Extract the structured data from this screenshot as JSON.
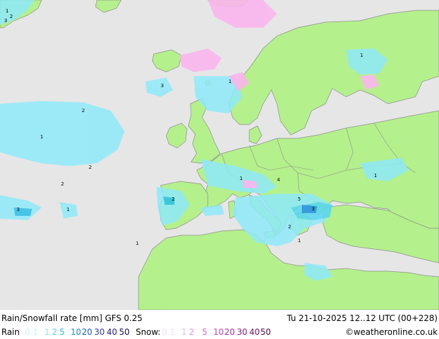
{
  "title": "Rain/Snowfall rate [mm] GFS 0.25",
  "datetime": "Tu 21-10-2025 12..12 UTC (00+228)",
  "credit": "©weatheronline.co.uk",
  "legend": {
    "rain_label": "Rain",
    "rain_scale": [
      {
        "v": "0.1",
        "c": "#bff5ff"
      },
      {
        "v": "1",
        "c": "#8ee9f9"
      },
      {
        "v": "2",
        "c": "#55d7f2"
      },
      {
        "v": "5",
        "c": "#2bbfe6"
      },
      {
        "v": "10",
        "c": "#1b8fdc"
      },
      {
        "v": "20",
        "c": "#1a5fc8"
      },
      {
        "v": "30",
        "c": "#2a39a8"
      },
      {
        "v": "40",
        "c": "#221e88"
      },
      {
        "v": "50",
        "c": "#150f60"
      }
    ],
    "snow_label": "Snow:",
    "snow_scale": [
      {
        "v": "0.1",
        "c": "#ffd9f7"
      },
      {
        "v": "1",
        "c": "#fbb5ee"
      },
      {
        "v": "2",
        "c": "#f58ce0"
      },
      {
        "v": "5",
        "c": "#ec5dcf"
      },
      {
        "v": "10",
        "c": "#d83bbb"
      },
      {
        "v": "20",
        "c": "#b82aa0"
      },
      {
        "v": "30",
        "c": "#941c85"
      },
      {
        "v": "40",
        "c": "#721268"
      },
      {
        "v": "50",
        "c": "#520a4c"
      }
    ]
  },
  "map_labels": [
    "1",
    "2",
    "3",
    "4",
    "1",
    "2",
    "5"
  ],
  "colors": {
    "sea": "#e6e6e6",
    "land": "#b4f08c",
    "border": "#8c8c8c"
  }
}
